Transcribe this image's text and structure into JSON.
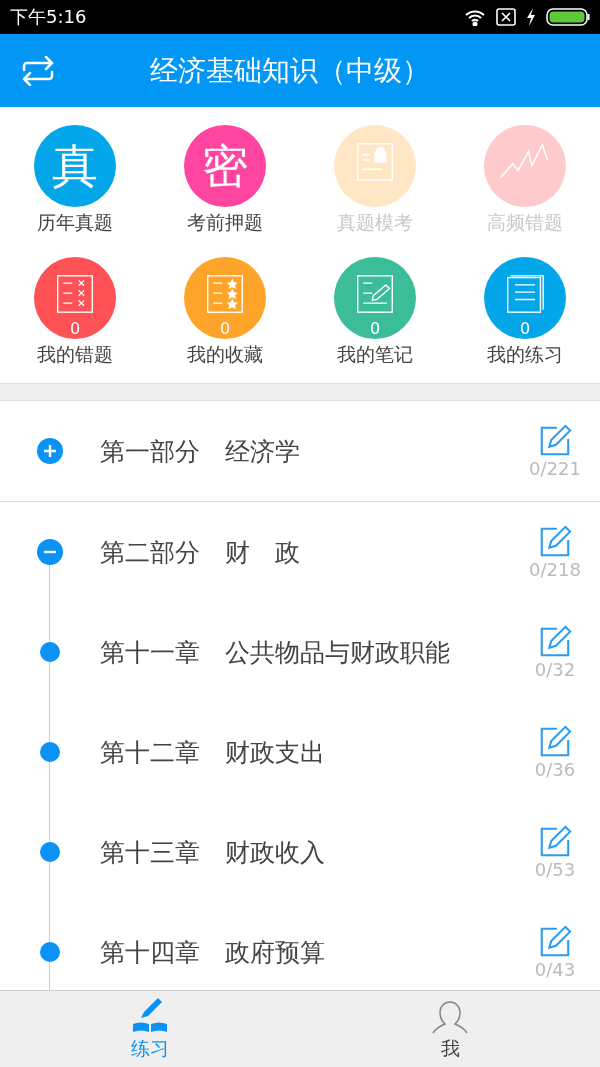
{
  "status_bar": {
    "time": "下午5:16"
  },
  "header": {
    "title": "经济基础知识（中级）"
  },
  "shortcuts": [
    {
      "label": "历年真题",
      "kind": "glyph",
      "glyph": "真",
      "color": "#04a6ea",
      "disabled": false
    },
    {
      "label": "考前押题",
      "kind": "glyph",
      "glyph": "密",
      "color": "#fe46a0",
      "disabled": false
    },
    {
      "label": "真题模考",
      "kind": "robot-doc",
      "color": "#ffe6c4",
      "disabled": true
    },
    {
      "label": "高频错题",
      "kind": "zigzag",
      "color": "#ffcacc",
      "disabled": true
    },
    {
      "label": "我的错题",
      "kind": "cross-list",
      "color": "#fe5257",
      "disabled": false,
      "count": "0"
    },
    {
      "label": "我的收藏",
      "kind": "star-list",
      "color": "#fea42a",
      "disabled": false,
      "count": "0"
    },
    {
      "label": "我的笔记",
      "kind": "note",
      "color": "#3bbd9a",
      "disabled": false,
      "count": "0"
    },
    {
      "label": "我的练习",
      "kind": "book",
      "color": "#04a6ea",
      "disabled": false,
      "count": "0"
    }
  ],
  "sections": [
    {
      "title": "第一部分　经济学",
      "progress": "0/221",
      "expanded": false
    },
    {
      "title": "第二部分　财　政",
      "progress": "0/218",
      "expanded": true,
      "children": [
        {
          "title": "第十一章　公共物品与财政职能",
          "progress": "0/32"
        },
        {
          "title": "第十二章　财政支出",
          "progress": "0/36"
        },
        {
          "title": "第十三章　财政收入",
          "progress": "0/53"
        },
        {
          "title": "第十四章　政府预算",
          "progress": "0/43"
        }
      ]
    }
  ],
  "tabs": [
    {
      "label": "练习",
      "kind": "practice",
      "selected": true
    },
    {
      "label": "我",
      "kind": "profile",
      "selected": false
    }
  ]
}
